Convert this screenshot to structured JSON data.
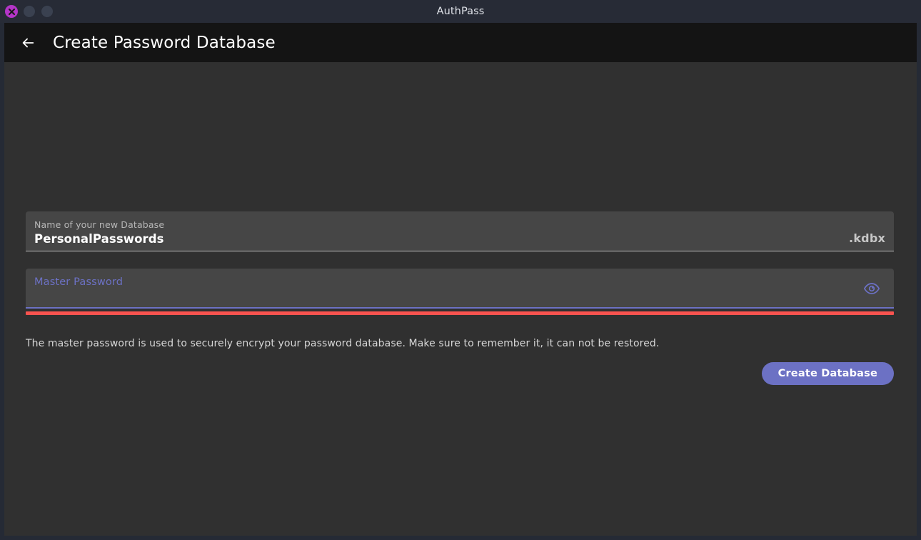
{
  "window": {
    "title": "AuthPass",
    "controls": {
      "close": "close-button",
      "minimize": "minimize-button",
      "maximize": "maximize-button"
    },
    "accent_close_color": "#b435c8"
  },
  "appbar": {
    "back_icon": "arrow-left-icon",
    "title": "Create Password Database"
  },
  "form": {
    "name_field": {
      "label": "Name of your new Database",
      "value": "PersonalPasswords",
      "suffix": ".kdbx",
      "placeholder": "Name of your new Database"
    },
    "password_field": {
      "label": "Master Password",
      "placeholder": "Master Password",
      "value": "",
      "reveal_icon": "eye-icon",
      "has_error": true,
      "error_color": "#f9534f",
      "focus_color": "#6c71c4"
    },
    "helper_text": "The master password is used to securely encrypt your password database. Make sure to remember it, it can not be restored.",
    "submit_label": "Create Database",
    "accent_color": "#6c71c4"
  },
  "theme": {
    "titlebar_bg": "#272b36",
    "appbar_bg": "#141414",
    "body_bg": "#303030",
    "field_bg": "#464646"
  }
}
